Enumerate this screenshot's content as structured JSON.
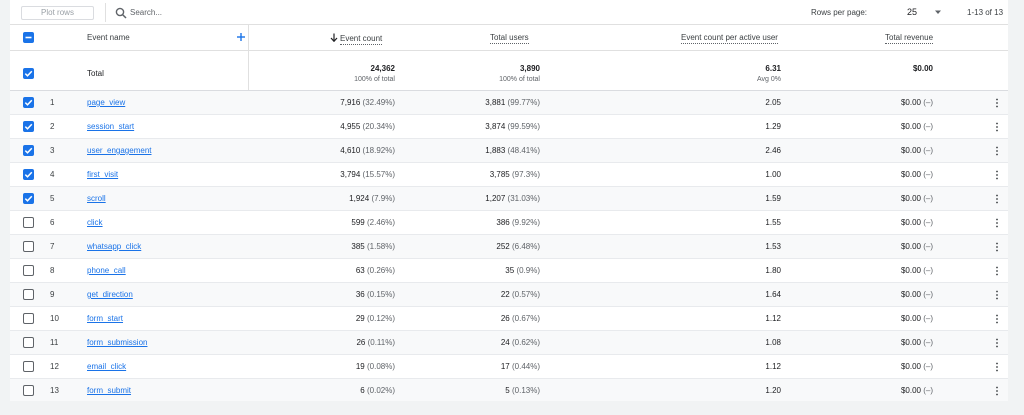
{
  "toolbar": {
    "plot_rows_label": "Plot rows",
    "search_placeholder": "Search...",
    "rows_per_page_label": "Rows per page:",
    "rows_per_page_value": "25",
    "range_text": "1-13 of 13"
  },
  "columns": {
    "event_name": "Event name",
    "event_count": "Event count",
    "total_users": "Total users",
    "event_count_per_active_user": "Event count per active user",
    "total_revenue": "Total revenue"
  },
  "totals": {
    "label": "Total",
    "event_count": "24,362",
    "event_count_sub": "100% of total",
    "total_users": "3,890",
    "total_users_sub": "100% of total",
    "per_user": "6.31",
    "per_user_sub": "Avg 0%",
    "revenue": "$0.00"
  },
  "rows": [
    {
      "index": "1",
      "name": "page_view",
      "checked": true,
      "count": "7,916",
      "count_pct": "(32.49%)",
      "users": "3,881",
      "users_pct": "(99.77%)",
      "per_user": "2.05",
      "revenue": "$0.00",
      "revenue_pct": "(–)"
    },
    {
      "index": "2",
      "name": "session_start",
      "checked": true,
      "count": "4,955",
      "count_pct": "(20.34%)",
      "users": "3,874",
      "users_pct": "(99.59%)",
      "per_user": "1.29",
      "revenue": "$0.00",
      "revenue_pct": "(–)"
    },
    {
      "index": "3",
      "name": "user_engagement",
      "checked": true,
      "count": "4,610",
      "count_pct": "(18.92%)",
      "users": "1,883",
      "users_pct": "(48.41%)",
      "per_user": "2.46",
      "revenue": "$0.00",
      "revenue_pct": "(–)"
    },
    {
      "index": "4",
      "name": "first_visit",
      "checked": true,
      "count": "3,794",
      "count_pct": "(15.57%)",
      "users": "3,785",
      "users_pct": "(97.3%)",
      "per_user": "1.00",
      "revenue": "$0.00",
      "revenue_pct": "(–)"
    },
    {
      "index": "5",
      "name": "scroll",
      "checked": true,
      "count": "1,924",
      "count_pct": "(7.9%)",
      "users": "1,207",
      "users_pct": "(31.03%)",
      "per_user": "1.59",
      "revenue": "$0.00",
      "revenue_pct": "(–)"
    },
    {
      "index": "6",
      "name": "click",
      "checked": false,
      "count": "599",
      "count_pct": "(2.46%)",
      "users": "386",
      "users_pct": "(9.92%)",
      "per_user": "1.55",
      "revenue": "$0.00",
      "revenue_pct": "(–)"
    },
    {
      "index": "7",
      "name": "whatsapp_click",
      "checked": false,
      "count": "385",
      "count_pct": "(1.58%)",
      "users": "252",
      "users_pct": "(6.48%)",
      "per_user": "1.53",
      "revenue": "$0.00",
      "revenue_pct": "(–)"
    },
    {
      "index": "8",
      "name": "phone_call",
      "checked": false,
      "count": "63",
      "count_pct": "(0.26%)",
      "users": "35",
      "users_pct": "(0.9%)",
      "per_user": "1.80",
      "revenue": "$0.00",
      "revenue_pct": "(–)"
    },
    {
      "index": "9",
      "name": "get_direction",
      "checked": false,
      "count": "36",
      "count_pct": "(0.15%)",
      "users": "22",
      "users_pct": "(0.57%)",
      "per_user": "1.64",
      "revenue": "$0.00",
      "revenue_pct": "(–)"
    },
    {
      "index": "10",
      "name": "form_start",
      "checked": false,
      "count": "29",
      "count_pct": "(0.12%)",
      "users": "26",
      "users_pct": "(0.67%)",
      "per_user": "1.12",
      "revenue": "$0.00",
      "revenue_pct": "(–)"
    },
    {
      "index": "11",
      "name": "form_submission",
      "checked": false,
      "count": "26",
      "count_pct": "(0.11%)",
      "users": "24",
      "users_pct": "(0.62%)",
      "per_user": "1.08",
      "revenue": "$0.00",
      "revenue_pct": "(–)"
    },
    {
      "index": "12",
      "name": "email_click",
      "checked": false,
      "count": "19",
      "count_pct": "(0.08%)",
      "users": "17",
      "users_pct": "(0.44%)",
      "per_user": "1.12",
      "revenue": "$0.00",
      "revenue_pct": "(–)"
    },
    {
      "index": "13",
      "name": "form_submit",
      "checked": false,
      "count": "6",
      "count_pct": "(0.02%)",
      "users": "5",
      "users_pct": "(0.13%)",
      "per_user": "1.20",
      "revenue": "$0.00",
      "revenue_pct": "(–)"
    }
  ],
  "icons": {
    "search": "search-icon",
    "dropdown": "caret-down-icon",
    "add": "plus-icon",
    "sort": "arrow-down-icon",
    "row_menu": "more-vert-icon",
    "select_all": "indeterminate-checkbox-icon"
  },
  "colors": {
    "accent": "#1a73e8",
    "link": "#1a73e8"
  }
}
